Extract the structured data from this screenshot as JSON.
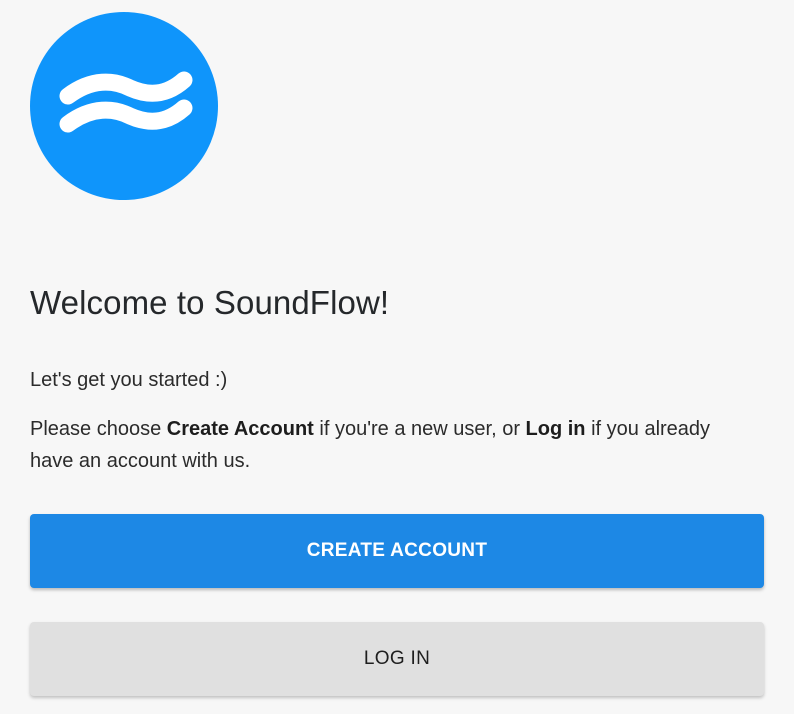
{
  "logo": {
    "icon": "wave-icon",
    "color": "#0f95fb"
  },
  "welcome": {
    "title": "Welcome to SoundFlow!",
    "subtitle": "Let's get you started :)",
    "instruction_prefix": "Please choose ",
    "instruction_create": "Create Account",
    "instruction_middle": " if you're a new user, or ",
    "instruction_login": "Log in",
    "instruction_suffix": " if you already have an account with us."
  },
  "buttons": {
    "create_account": "CREATE ACCOUNT",
    "log_in": "LOG IN",
    "primary_color": "#1d88e5",
    "secondary_color": "#e0e0e0"
  }
}
